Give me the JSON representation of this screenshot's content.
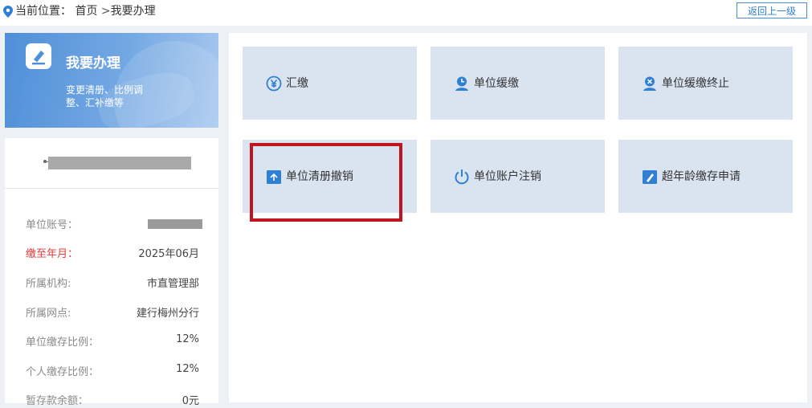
{
  "breadcrumb": {
    "prefix": "当前位置：",
    "home": "首页",
    "separator": " >",
    "current": "我要办理"
  },
  "back_button": "返回上一级",
  "banner": {
    "title": "我要办理",
    "subtitle": "变更清册、比例调整、汇补缴等"
  },
  "info": {
    "rows": [
      {
        "label": "单位账号：",
        "value": ""
      },
      {
        "label": "缴至年月：",
        "value": "2025年06月"
      },
      {
        "label": "所属机构:",
        "value": "市直管理部"
      },
      {
        "label": "所属网点:",
        "value": "建行梅州分行"
      },
      {
        "label": "单位缴存比例：",
        "value": "12%"
      },
      {
        "label": "个人缴存比例：",
        "value": "12%"
      },
      {
        "label": "暂存款余额：",
        "value": "0元"
      }
    ]
  },
  "tiles": [
    {
      "label": "汇缴",
      "icon": "yen-circle-icon"
    },
    {
      "label": "单位缓缴",
      "icon": "clock-person-icon"
    },
    {
      "label": "单位缓缴终止",
      "icon": "person-stop-icon"
    },
    {
      "label": "单位清册撤销",
      "icon": "return-arrow-icon"
    },
    {
      "label": "单位账户注销",
      "icon": "power-icon"
    },
    {
      "label": "超年龄缴存申请",
      "icon": "edit-doc-icon"
    }
  ],
  "colors": {
    "accent": "#2f7fd3",
    "tile_bg": "#dae4f1",
    "highlight_border": "#c0151c",
    "alert_label": "#e33b3b"
  }
}
